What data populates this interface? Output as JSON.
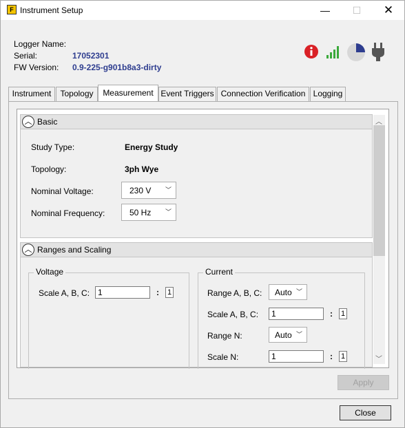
{
  "window": {
    "app_icon_text": "F",
    "title": "Instrument Setup",
    "minimize": "—",
    "maximize": "☐",
    "close": "✕"
  },
  "info": {
    "logger_name_label": "Logger Name:",
    "logger_name_value": "",
    "serial_label": "Serial:",
    "serial_value": "17052301",
    "fw_label": "FW Version:",
    "fw_value": "0.9-225-g901b8a3-dirty"
  },
  "status_icons": {
    "alert": "alert-icon",
    "signal": "signal-strength-icon",
    "memory": "memory-pie-icon",
    "power": "power-plug-icon",
    "colors": {
      "alert": "#d92126",
      "signal": "#3aa93a",
      "pie_fill": "#2e3d8f",
      "pie_bg": "#d8d8d8",
      "plug": "#555555"
    }
  },
  "tabs": [
    {
      "label": "Instrument"
    },
    {
      "label": "Topology"
    },
    {
      "label": "Measurement"
    },
    {
      "label": "Event Triggers"
    },
    {
      "label": "Connection Verification"
    },
    {
      "label": "Logging"
    }
  ],
  "active_tab": "Measurement",
  "basic": {
    "title": "Basic",
    "study_type_label": "Study Type:",
    "study_type_value": "Energy Study",
    "topology_label": "Topology:",
    "topology_value": "3ph Wye",
    "nominal_voltage_label": "Nominal Voltage:",
    "nominal_voltage_value": "230 V",
    "nominal_frequency_label": "Nominal Frequency:",
    "nominal_frequency_value": "50 Hz"
  },
  "ranges": {
    "title": "Ranges and Scaling",
    "voltage": {
      "title": "Voltage",
      "scale_label": "Scale A, B, C:",
      "scale_value": "1",
      "ratio_sep": ":",
      "ratio_value": "1"
    },
    "current": {
      "title": "Current",
      "range_abc_label": "Range A, B, C:",
      "range_abc_value": "Auto",
      "scale_abc_label": "Scale A, B, C:",
      "scale_abc_value": "1",
      "scale_abc_ratio": "1",
      "range_n_label": "Range N:",
      "range_n_value": "Auto",
      "scale_n_label": "Scale N:",
      "scale_n_value": "1",
      "scale_n_ratio": "1",
      "ratio_sep": ":"
    }
  },
  "buttons": {
    "apply": "Apply",
    "close": "Close"
  }
}
